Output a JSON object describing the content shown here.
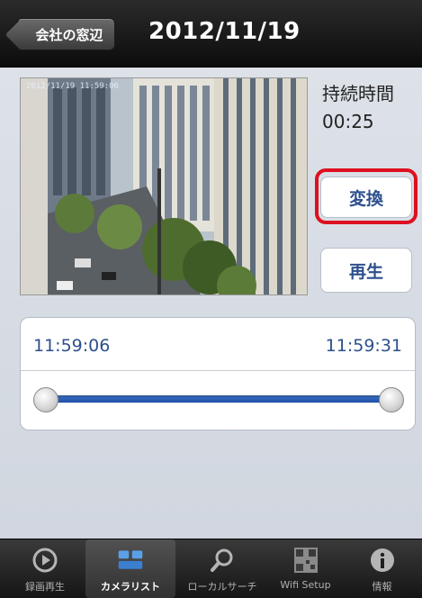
{
  "navbar": {
    "back_label": "会社の窓辺",
    "title": "2012/11/19"
  },
  "video": {
    "timestamp": "2012/11/19 11:59:06"
  },
  "side": {
    "duration_label": "持続時間",
    "duration_value": "00:25",
    "convert_label": "変換",
    "play_label": "再生"
  },
  "time_range": {
    "start": "11:59:06",
    "end": "11:59:31"
  },
  "tabs": [
    {
      "label": "録画再生",
      "icon": "playback-icon"
    },
    {
      "label": "カメラリスト",
      "icon": "camera-list-icon",
      "active": true
    },
    {
      "label": "ローカルサーチ",
      "icon": "search-icon"
    },
    {
      "label": "Wifi Setup",
      "icon": "qr-code-icon"
    },
    {
      "label": "情報",
      "icon": "info-icon"
    }
  ],
  "colors": {
    "accent_blue": "#2d4f8c",
    "highlight_red": "#dd1020",
    "slider_blue": "#2a5db6"
  }
}
